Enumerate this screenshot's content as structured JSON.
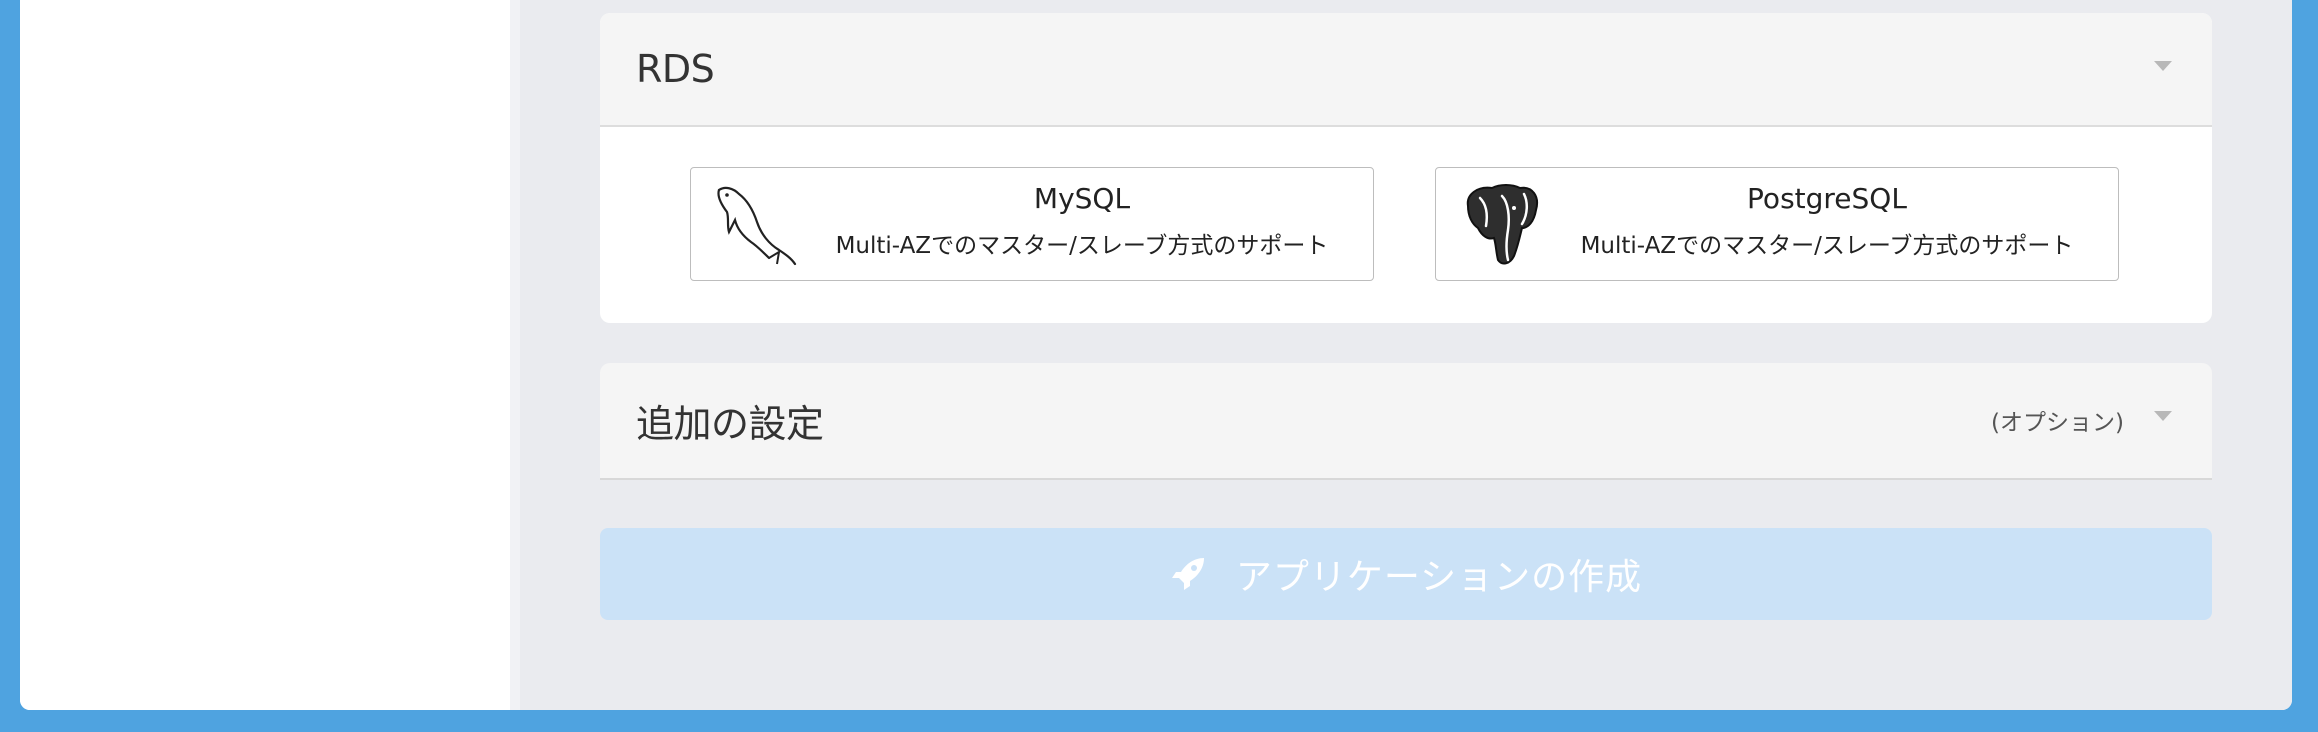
{
  "rds": {
    "title": "RDS",
    "engines": [
      {
        "name": "MySQL",
        "description": "Multi-AZでのマスター/スレーブ方式のサポート",
        "icon": "mysql-dolphin-icon"
      },
      {
        "name": "PostgreSQL",
        "description": "Multi-AZでのマスター/スレーブ方式のサポート",
        "icon": "postgresql-elephant-icon"
      }
    ]
  },
  "additional": {
    "title": "追加の設定",
    "hint": "(オプション)"
  },
  "create_button": {
    "label": "アプリケーションの作成",
    "icon": "rocket-icon"
  },
  "colors": {
    "background": "#4fa3e0",
    "button_disabled": "#cbe2f7"
  }
}
